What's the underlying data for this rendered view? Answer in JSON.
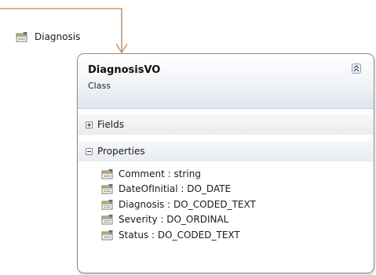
{
  "association": {
    "label": "Diagnosis"
  },
  "class_box": {
    "name": "DiagnosisVO",
    "stereotype": "Class",
    "compartments": {
      "fields": {
        "label": "Fields",
        "state": "collapsed"
      },
      "properties": {
        "label": "Properties",
        "state": "expanded",
        "items": [
          "Comment : string",
          "DateOfInitial : DO_DATE",
          "Diagnosis : DO_CODED_TEXT",
          "Severity : DO_ORDINAL",
          "Status : DO_CODED_TEXT"
        ]
      }
    }
  },
  "colors": {
    "connector": "#c8986a",
    "box_border": "#8c8c8c",
    "header_gradient_end": "#dfe6ef"
  },
  "icons": {
    "property": "property-icon",
    "collapse": "chevron-up-icon",
    "expand_fields": "plus-icon",
    "collapse_properties": "minus-icon"
  }
}
